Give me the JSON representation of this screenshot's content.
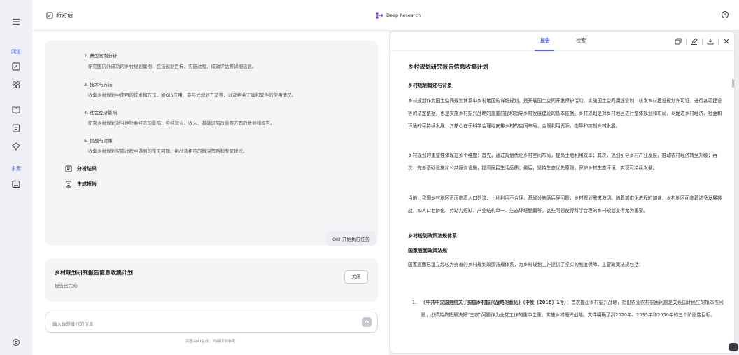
{
  "sidebar": {
    "history_label": "问道",
    "search_label": "求索"
  },
  "topbar": {
    "new_chat": "新对话",
    "deep_research": "Deep Research"
  },
  "chat": {
    "steps": [
      {
        "title": "2. 典型案例分析",
        "desc": "研究国内外成功的乡村规划案例，包括规划目标、实施过程、成效评估等详细信息。"
      },
      {
        "title": "3. 技术与方法",
        "desc": "收集乡村规划中使用的技术和方法，如GIS应用、参与式规划方法等，以及相关工具和软件的使用情况。"
      },
      {
        "title": "4. 社会经济影响",
        "desc": "研究乡村规划对当地社会经济的影响，包括就业、收入、基础设施改善等方面的数据和报告。"
      },
      {
        "title": "5. 挑战与对策",
        "desc": "收集乡村规划实施过程中遇到的常见问题、挑战及相应的解决策略和专家建议。"
      }
    ],
    "phases": [
      "分析结果",
      "生成报告"
    ],
    "start_message": "OK! 开始执行任务",
    "report_card": {
      "title": "乡村规划研究报告信息收集计划",
      "status": "报告已完成",
      "close": "关闭"
    },
    "input_placeholder": "输入你想查找的信息",
    "disclaimer": "回答由AI生成，内容仅供参考"
  },
  "panel": {
    "tabs": [
      "报告",
      "检索"
    ],
    "active_tab": "报告",
    "doc": {
      "title": "乡村规划研究报告信息收集计划",
      "section1": "乡村规划概述与背景",
      "p1": "乡村规划作为国土空间规划体系中乡村地区的详细规划，是开展国土空间开发保护活动、实施国土空间用途管制、核发乡村建设规划许可证、进行各项建设等的法定依据，也是实施乡村振兴战略的重要前提和指导乡村发展建设的基本依据。乡村规划是对乡村地区进行整体规划和布局，以促进乡村经济、社会和环境的可持续发展，其核心在于科学合理地安排乡村的空间布局，合理利用资源，指导和控制乡村发展。",
      "p2": "乡村规划的重要性体现在多个维度：首先，通过规划优化乡村空间布局，提高土地利用效率；其次，规划引导乡村产业发展，推动农村经济转型升级；再次，完善基础设施和公共服务设施，提高居民生活品质；最后，坚持生态优先原则，保护乡村生态环境，实现可持续发展。",
      "p3": "当前，我国乡村地区正面临着人口外流、土地利用不合理、基础设施落后等问题，乡村规划需求迫切。随着城市化进程的加速，乡村地区面临着诸多发展挑战，如人口老龄化、劳动力短缺、产业结构单一、生态环境脆弱等。这些问题使得科学合理的乡村规划变得尤为重要。",
      "section2": "乡村规划政策法规体系",
      "sub1": "国家层面政策法规",
      "p4": "国家层面已建立起较为完善的乡村规划政策法规体系，为乡村规划工作提供了坚实的制度保障。主要政策法规包括：",
      "item1_num": "1.",
      "item1_bold": "《中共中央国务院关于实施乡村振兴战略的意见》（中发〔2018〕1号）",
      "item1_rest": "：首次提出乡村振兴战略，指出农业农村农民问题是关系国计民生的根本性问题，必须始终把解决好“三农”问题作为全党工作的重中之重。实施乡村振兴战略。文件明确了到2020年、2035年和2050年的三个阶段性目标。"
    }
  },
  "colors": {
    "accent": "#4a5ff5",
    "sidebar_bg": "#eef0f5",
    "card_bg": "#f4f5f7"
  },
  "icons": [
    "menu-icon",
    "chat-icon",
    "discover-icon",
    "book-icon",
    "document-icon",
    "compass-icon",
    "search-history-icon",
    "settings-icon",
    "new-chat-icon",
    "deep-research-icon",
    "history-icon",
    "copy-icon",
    "edit-icon",
    "download-icon",
    "close-icon",
    "list-icon",
    "document-icon",
    "send-icon"
  ]
}
